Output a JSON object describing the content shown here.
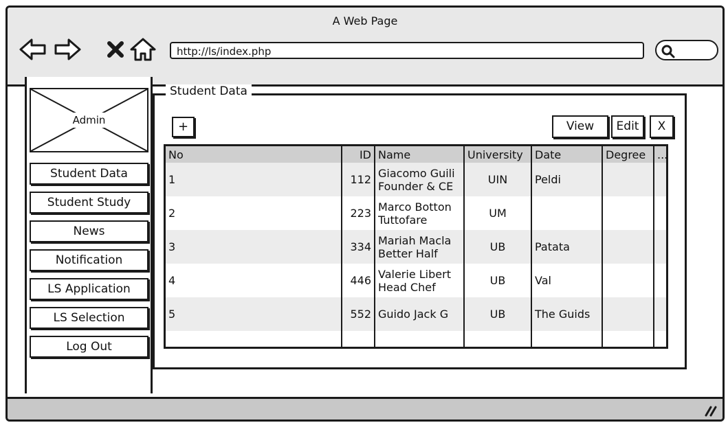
{
  "window": {
    "title": "A Web Page"
  },
  "browser": {
    "url": "http://ls/index.php"
  },
  "sidebar": {
    "admin_label": "Admin",
    "items": [
      {
        "label": "Student Data"
      },
      {
        "label": "Student Study"
      },
      {
        "label": "News"
      },
      {
        "label": "Notification"
      },
      {
        "label": "LS Application"
      },
      {
        "label": "LS Selection"
      },
      {
        "label": "Log Out"
      }
    ]
  },
  "main": {
    "group_title": "Student Data",
    "add_label": "+",
    "view_label": "View",
    "edit_label": "Edit",
    "close_label": "X",
    "table": {
      "headers": [
        "No",
        "ID",
        "Name",
        "University",
        "Date",
        "Degree",
        "..."
      ],
      "rows": [
        {
          "no": "1",
          "id": "112",
          "name1": "Giacomo Guili",
          "name2": "Founder & CE",
          "university": "UIN",
          "date": "Peldi",
          "degree": ""
        },
        {
          "no": "2",
          "id": "223",
          "name1": "Marco Botton",
          "name2": "Tuttofare",
          "university": "UM",
          "date": "",
          "degree": ""
        },
        {
          "no": "3",
          "id": "334",
          "name1": "Mariah Macla",
          "name2": "Better Half",
          "university": "UB",
          "date": "Patata",
          "degree": ""
        },
        {
          "no": "4",
          "id": "446",
          "name1": "Valerie Libert",
          "name2": "Head Chef",
          "university": "UB",
          "date": "Val",
          "degree": ""
        },
        {
          "no": "5",
          "id": "552",
          "name1": "Guido Jack G",
          "name2": "",
          "university": "UB",
          "date": "The Guids",
          "degree": ""
        }
      ]
    }
  },
  "icons": [
    "back-arrow-icon",
    "forward-arrow-icon",
    "stop-icon",
    "home-icon",
    "search-icon",
    "resize-grip-icon"
  ]
}
